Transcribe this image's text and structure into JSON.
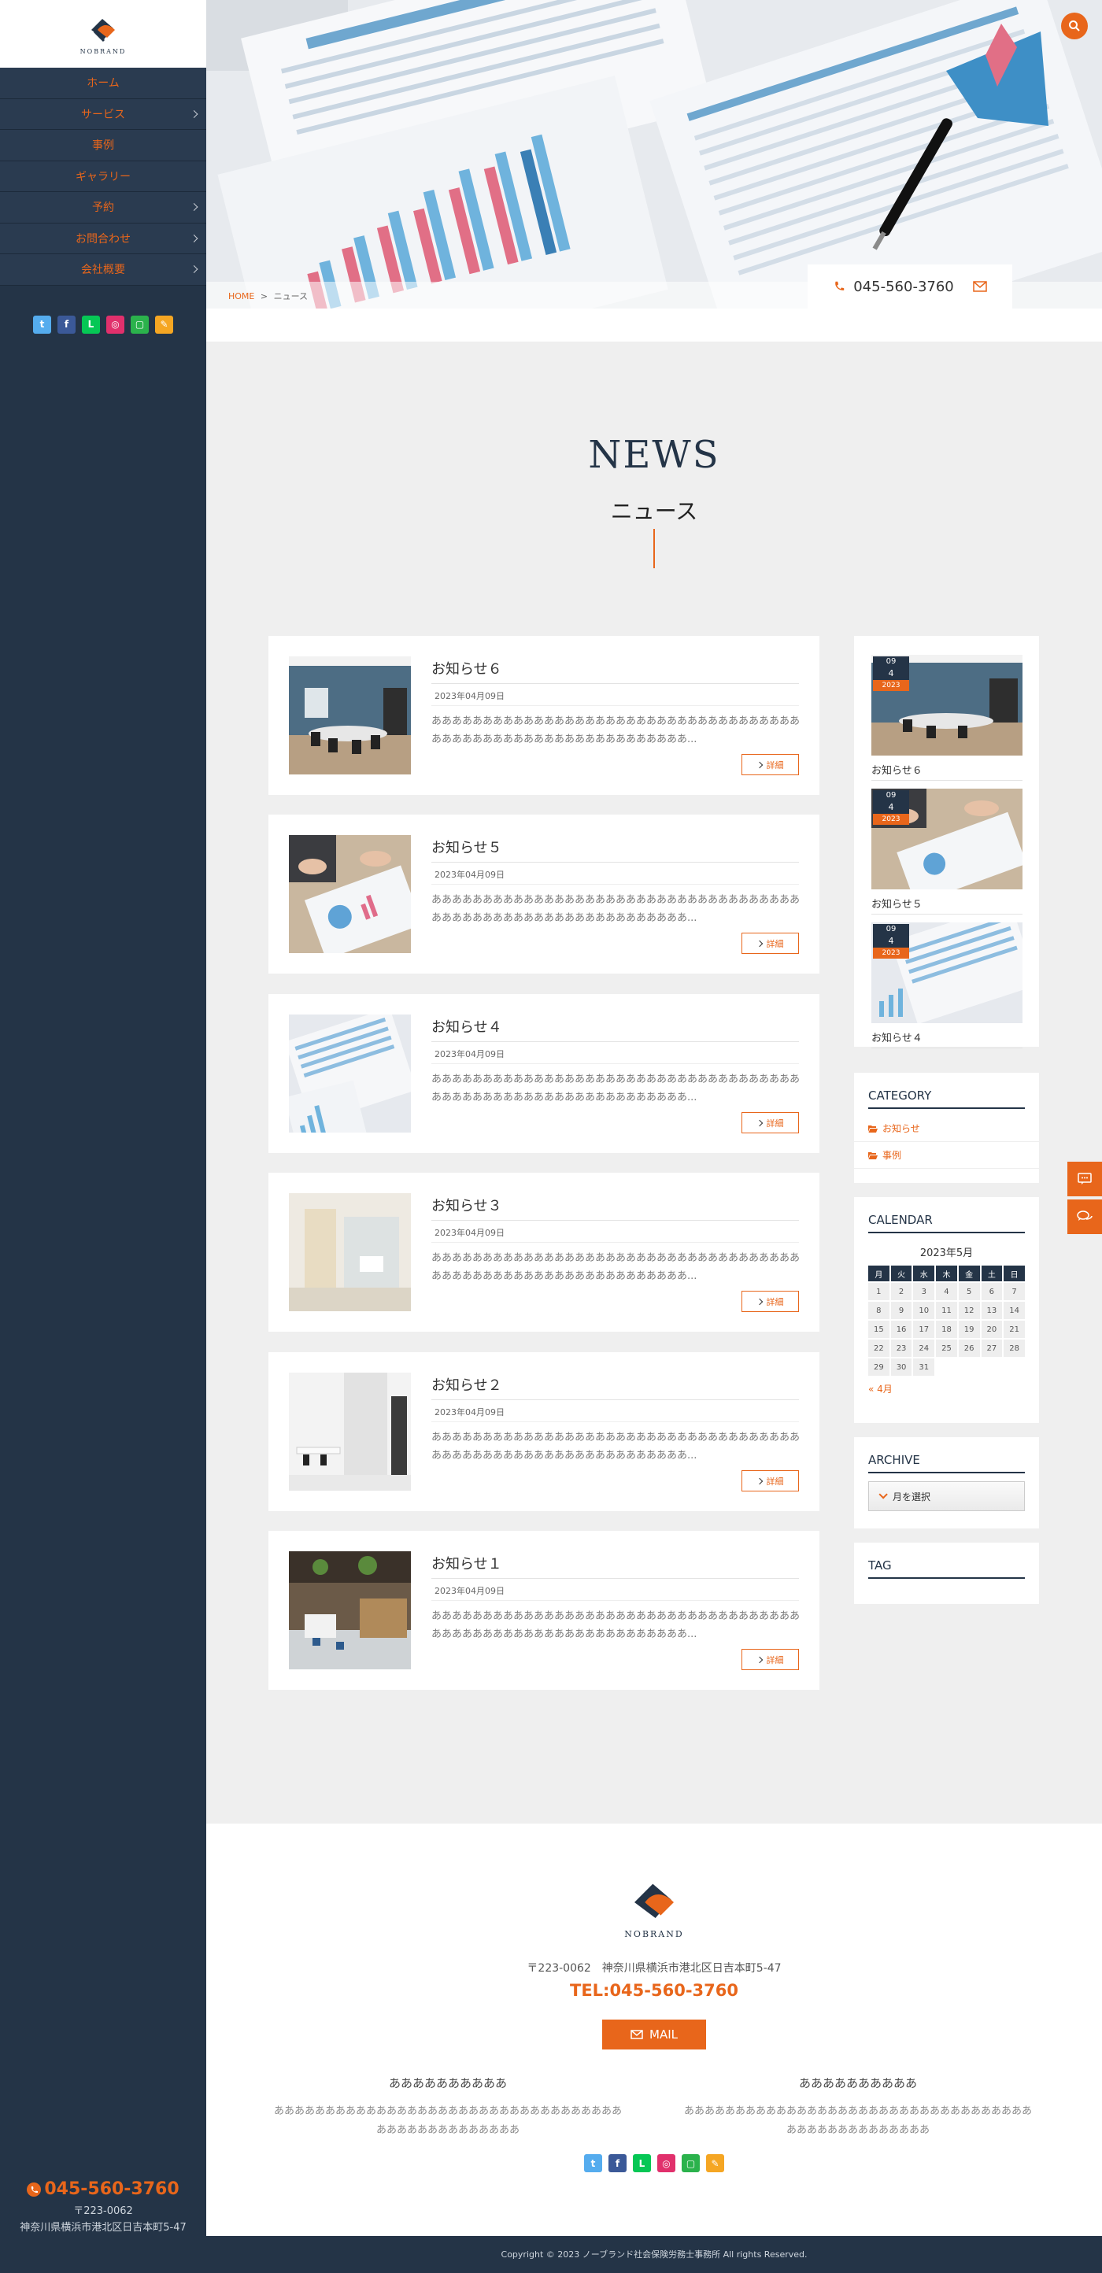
{
  "brand": {
    "name": "NOBRAND",
    "accent": "#e8661b",
    "navy": "#243447"
  },
  "nav": {
    "items": [
      {
        "label": "ホーム",
        "has_sub": false
      },
      {
        "label": "サービス",
        "has_sub": true
      },
      {
        "label": "事例",
        "has_sub": false
      },
      {
        "label": "ギャラリー",
        "has_sub": false
      },
      {
        "label": "予約",
        "has_sub": true
      },
      {
        "label": "お問合わせ",
        "has_sub": true
      },
      {
        "label": "会社概要",
        "has_sub": true
      }
    ]
  },
  "social": [
    {
      "name": "twitter-icon",
      "glyph": "t",
      "color": "#55acee"
    },
    {
      "name": "facebook-icon",
      "glyph": "f",
      "color": "#3b5998"
    },
    {
      "name": "line-icon",
      "glyph": "L",
      "color": "#06c755"
    },
    {
      "name": "instagram-icon",
      "glyph": "◎",
      "color": "#e1306c"
    },
    {
      "name": "feedly-icon",
      "glyph": "▢",
      "color": "#2bb24c"
    },
    {
      "name": "note-icon",
      "glyph": "✎",
      "color": "#f5a623"
    }
  ],
  "sidebar_bottom": {
    "phone": "045-560-3760",
    "zip": "〒223-0062",
    "address": "神奈川県横浜市港北区日吉本町5-47"
  },
  "hero": {
    "phone": "045-560-3760"
  },
  "breadcrumb": {
    "home": "HOME",
    "sep": ">",
    "current": "ニュース"
  },
  "page": {
    "title_en": "NEWS",
    "title_ja": "ニュース"
  },
  "posts": [
    {
      "title": "お知らせ６",
      "date": "2023年04月09日",
      "excerpt": "あああああああああああああああああああああああああああああああああああああああああああああああああああああああああああああ...",
      "more": "詳細"
    },
    {
      "title": "お知らせ５",
      "date": "2023年04月09日",
      "excerpt": "あああああああああああああああああああああああああああああああああああああああああああああああああああああああああああああ...",
      "more": "詳細"
    },
    {
      "title": "お知らせ４",
      "date": "2023年04月09日",
      "excerpt": "あああああああああああああああああああああああああああああああああああああああああああああああああああああああああああああ...",
      "more": "詳細"
    },
    {
      "title": "お知らせ３",
      "date": "2023年04月09日",
      "excerpt": "あああああああああああああああああああああああああああああああああああああああああああああああああああああああああああああ...",
      "more": "詳細"
    },
    {
      "title": "お知らせ２",
      "date": "2023年04月09日",
      "excerpt": "あああああああああああああああああああああああああああああああああああああああああああああああああああああああああああああ...",
      "more": "詳細"
    },
    {
      "title": "お知らせ１",
      "date": "2023年04月09日",
      "excerpt": "あああああああああああああああああああああああああああああああああああああああああああああああああああああああああああああ...",
      "more": "詳細"
    }
  ],
  "recent": [
    {
      "title": "お知らせ６",
      "month": "09",
      "day": "4",
      "year": "2023"
    },
    {
      "title": "お知らせ５",
      "month": "09",
      "day": "4",
      "year": "2023"
    },
    {
      "title": "お知らせ４",
      "month": "09",
      "day": "4",
      "year": "2023"
    }
  ],
  "category": {
    "title": "CATEGORY",
    "items": [
      "お知らせ",
      "事例"
    ]
  },
  "calendar": {
    "title": "CALENDAR",
    "caption": "2023年5月",
    "weekdays": [
      "月",
      "火",
      "水",
      "木",
      "金",
      "土",
      "日"
    ],
    "weeks": [
      [
        "1",
        "2",
        "3",
        "4",
        "5",
        "6",
        "7"
      ],
      [
        "8",
        "9",
        "10",
        "11",
        "12",
        "13",
        "14"
      ],
      [
        "15",
        "16",
        "17",
        "18",
        "19",
        "20",
        "21"
      ],
      [
        "22",
        "23",
        "24",
        "25",
        "26",
        "27",
        "28"
      ],
      [
        "29",
        "30",
        "31",
        "",
        "",
        "",
        ""
      ]
    ],
    "prev": "« 4月"
  },
  "archive": {
    "title": "ARCHIVE",
    "select": "月を選択"
  },
  "tag": {
    "title": "TAG"
  },
  "footer": {
    "logo": "NOBRAND",
    "address": "〒223-0062　神奈川県横浜市港北区日吉本町5-47",
    "tel": "TEL:045-560-3760",
    "mail": "MAIL",
    "cols": [
      {
        "heading": "ああああああああああ",
        "body": "ああああああああああああああああああああああああああああああああああああああああああああああああ"
      },
      {
        "heading": "ああああああああああ",
        "body": "ああああああああああああああああああああああああああああああああああああああああああああああああ"
      }
    ]
  },
  "copyright": "Copyright © 2023 ノーブランド社会保険労務士事務所 All rights Reserved."
}
